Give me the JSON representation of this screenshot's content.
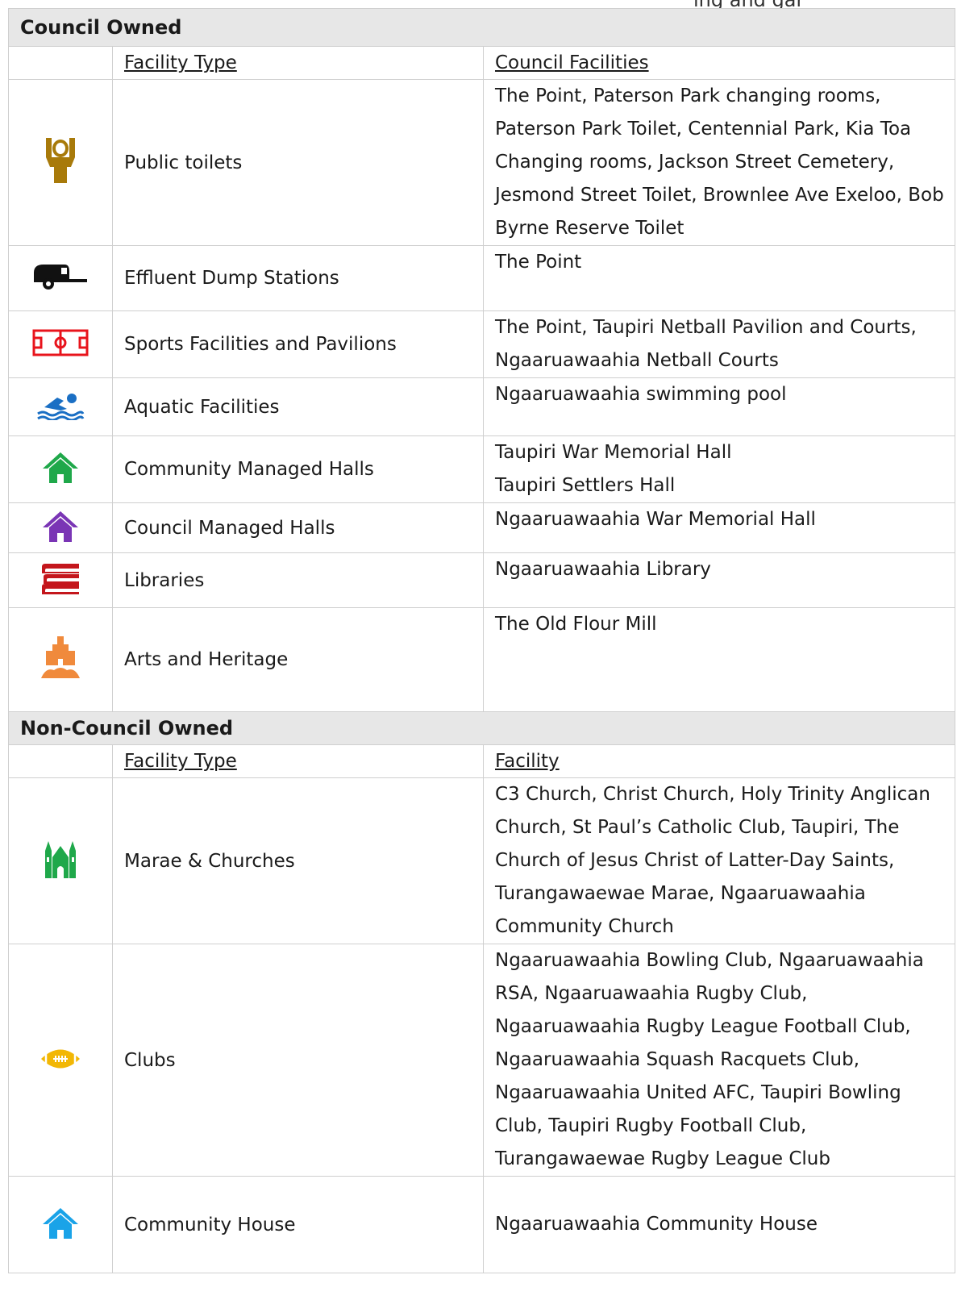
{
  "page": {
    "top_clipped_text": "ing and gar"
  },
  "council_owned": {
    "title": "Council Owned",
    "col_type": "Facility Type",
    "col_facilities": "Council Facilities",
    "rows": [
      {
        "icon": "toilet-icon",
        "color": "#a87a0a",
        "type": "Public toilets",
        "facilities": "The Point, Paterson Park changing rooms, Paterson Park Toilet, Centennial Park, Kia Toa Changing rooms, Jackson Street Cemetery, Jesmond Street Toilet, Brownlee Ave Exeloo, Bob Byrne Reserve Toilet"
      },
      {
        "icon": "caravan-icon",
        "color": "#111111",
        "type": "Effluent Dump Stations",
        "facilities": "The Point"
      },
      {
        "icon": "sports-field-icon",
        "color": "#e8141c",
        "type": "Sports Facilities and Pavilions",
        "facilities": "The Point, Taupiri Netball Pavilion and Courts, Ngaaruawaahia Netball Courts"
      },
      {
        "icon": "swimmer-icon",
        "color": "#1a6fc4",
        "type": "Aquatic Facilities",
        "facilities": "Ngaaruawaahia swimming pool"
      },
      {
        "icon": "house-icon",
        "color": "#1fa84a",
        "type": "Community Managed Halls",
        "facilities_line1": "Taupiri War Memorial Hall",
        "facilities_line2": "Taupiri Settlers Hall"
      },
      {
        "icon": "house-icon",
        "color": "#7a35b5",
        "type": "Council Managed Halls",
        "facilities": "Ngaaruawaahia War Memorial Hall"
      },
      {
        "icon": "books-icon",
        "color": "#c4161c",
        "type": "Libraries",
        "facilities": "Ngaaruawaahia Library"
      },
      {
        "icon": "castle-icon",
        "color": "#f08a3c",
        "type": "Arts and Heritage",
        "facilities": "The Old Flour Mill"
      }
    ]
  },
  "non_council_owned": {
    "title": "Non-Council Owned",
    "col_type": "Facility Type",
    "col_facilities": "Facility",
    "rows": [
      {
        "icon": "church-icon",
        "color": "#1fa84a",
        "type": "Marae & Churches",
        "facilities": "C3 Church, Christ Church, Holy Trinity Anglican Church, St Paul’s Catholic Club, Taupiri, The Church of Jesus Christ of Latter-Day Saints, Turangawaewae Marae, Ngaaruawaahia Community Church"
      },
      {
        "icon": "football-icon",
        "color": "#f2b705",
        "type": "Clubs",
        "facilities": "Ngaaruawaahia Bowling Club, Ngaaruawaahia RSA, Ngaaruawaahia Rugby Club, Ngaaruawaahia Rugby League Football Club, Ngaaruawaahia Squash Racquets Club, Ngaaruawaahia United AFC, Taupiri Bowling Club, Taupiri Rugby Football Club, Turangawaewae Rugby League Club"
      },
      {
        "icon": "house-icon",
        "color": "#1aa3e8",
        "type": "Community House",
        "facilities": "Ngaaruawaahia Community House"
      }
    ]
  }
}
